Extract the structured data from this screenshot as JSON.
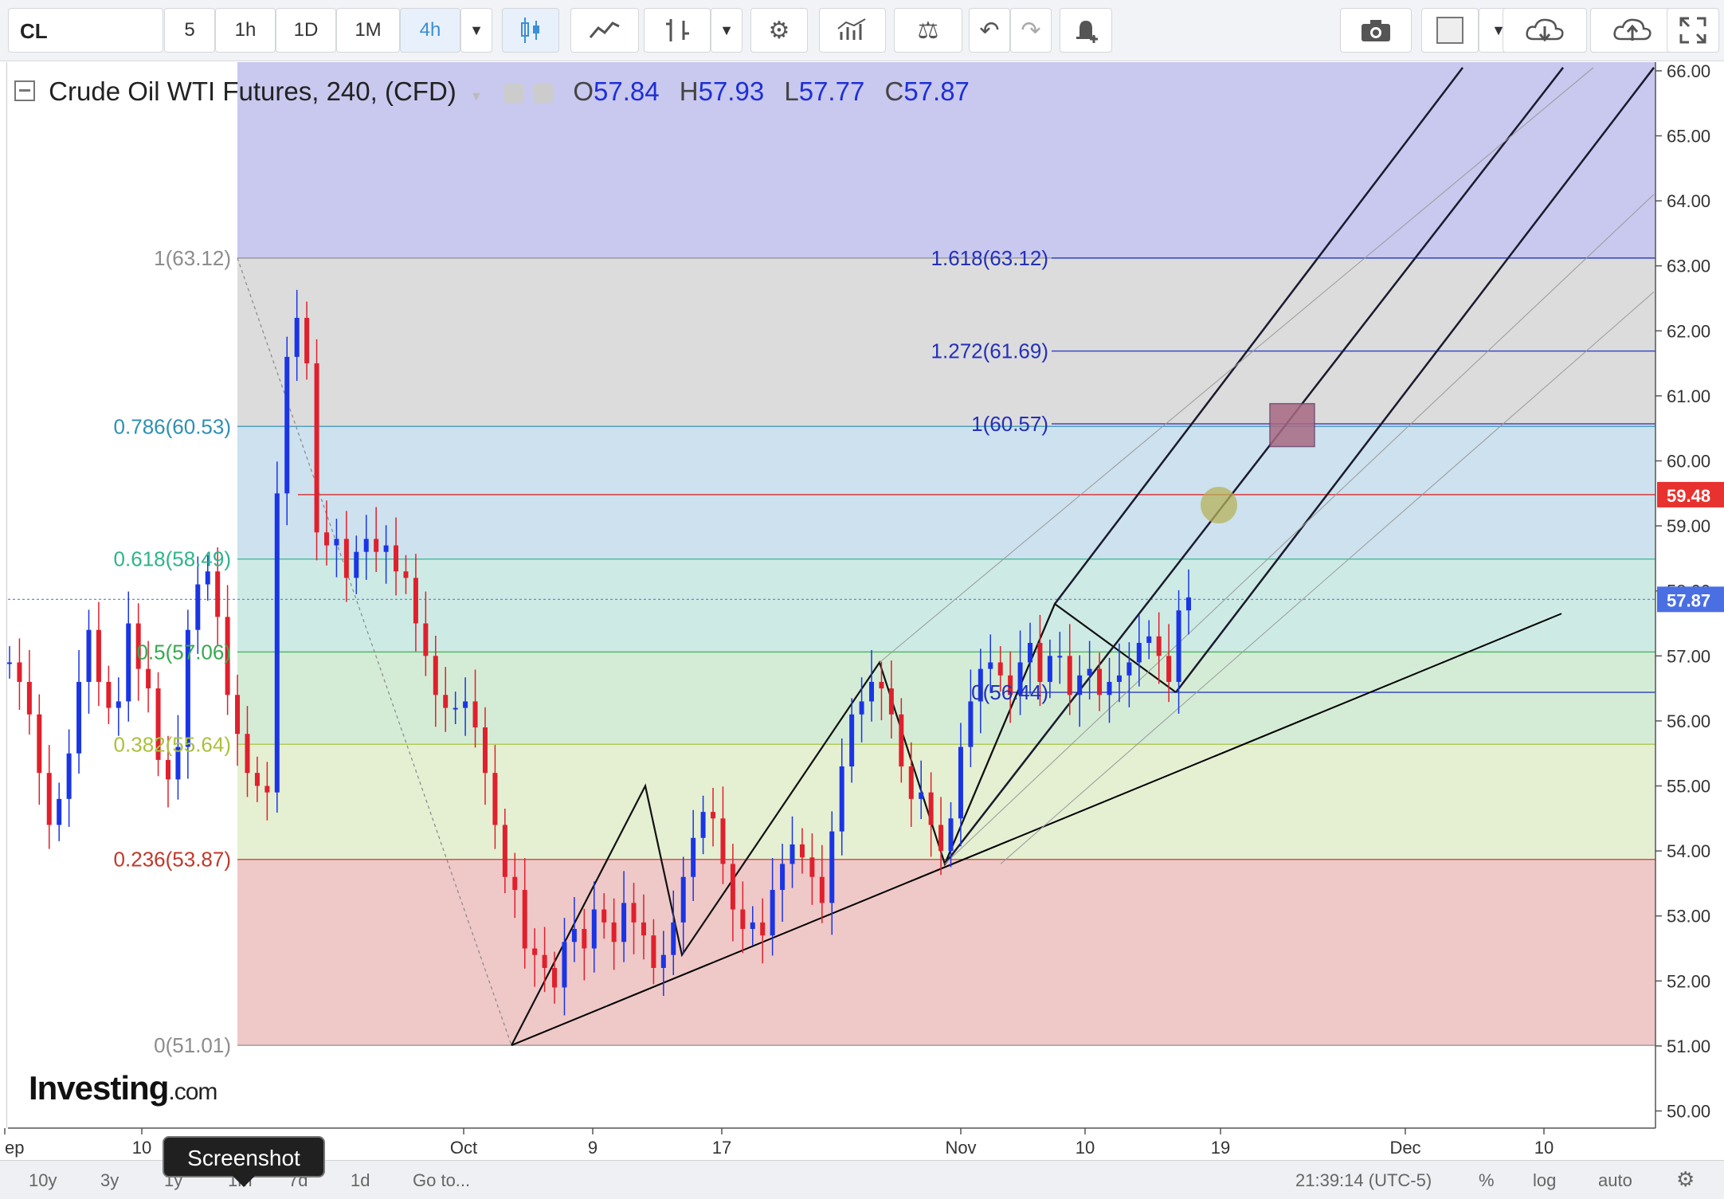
{
  "toolbar": {
    "symbol": "CL",
    "intervals": [
      "5",
      "1h",
      "1D",
      "1M",
      "4h"
    ],
    "active_interval": "4h"
  },
  "legend": {
    "title": "Crude Oil WTI Futures, 240, (CFD)",
    "open_label": "O",
    "open": "57.84",
    "high_label": "H",
    "high": "57.93",
    "low_label": "L",
    "low": "57.77",
    "close_label": "C",
    "close": "57.87"
  },
  "logo": {
    "main": "Investing",
    "suffix": ".com"
  },
  "bottom_bar": {
    "ranges": [
      "10y",
      "3y",
      "1y",
      "1m",
      "7d",
      "1d"
    ],
    "goto": "Go to...",
    "time": "21:39:14 (UTC-5)",
    "percent": "%",
    "log": "log",
    "auto": "auto"
  },
  "tooltip": {
    "text": "Screenshot"
  },
  "chart_data": {
    "type": "candlestick",
    "ylim": [
      49.6,
      66.1
    ],
    "y_ticks": [
      "50.00",
      "51.00",
      "52.00",
      "53.00",
      "54.00",
      "55.00",
      "56.00",
      "57.00",
      "58.00",
      "59.00",
      "60.00",
      "61.00",
      "62.00",
      "63.00",
      "64.00",
      "65.00",
      "66.00"
    ],
    "x_ticks": [
      "ep",
      "10",
      "Oct",
      "9",
      "17",
      "Nov",
      "10",
      "19",
      "Dec",
      "10"
    ],
    "price_label": "57.87",
    "alert_label": "59.48",
    "fib_retracement": [
      {
        "label": "1(63.12)",
        "value": 63.12,
        "color": "#8c8c8c"
      },
      {
        "label": "0.786(60.53)",
        "value": 60.53,
        "color": "#2f8fb4"
      },
      {
        "label": "0.618(58.49)",
        "value": 58.49,
        "color": "#2fb48c"
      },
      {
        "label": "0.5(57.06)",
        "value": 57.06,
        "color": "#36a94e"
      },
      {
        "label": "0.382(55.64)",
        "value": 55.64,
        "color": "#a9c23c"
      },
      {
        "label": "0.236(53.87)",
        "value": 53.87,
        "color": "#c0392b"
      },
      {
        "label": "0(51.01)",
        "value": 51.01,
        "color": "#8c8c8c"
      }
    ],
    "fib_extension": [
      {
        "label": "1.618(63.12)",
        "value": 63.12
      },
      {
        "label": "1.272(61.69)",
        "value": 61.69
      },
      {
        "label": "1(60.57)",
        "value": 60.57
      },
      {
        "label": "0(56.44)",
        "value": 56.44
      }
    ],
    "close_series": [
      56.9,
      56.6,
      56.1,
      55.2,
      54.4,
      54.8,
      55.5,
      56.6,
      57.4,
      56.6,
      56.2,
      56.3,
      57.5,
      56.8,
      56.5,
      55.4,
      55.1,
      55.6,
      57.4,
      58.1,
      58.3,
      57.6,
      56.4,
      55.8,
      55.2,
      55.0,
      54.9,
      59.5,
      61.6,
      62.2,
      61.5,
      58.9,
      58.7,
      58.8,
      58.2,
      58.6,
      58.8,
      58.6,
      58.7,
      58.3,
      58.2,
      57.5,
      57.0,
      56.4,
      56.2,
      56.2,
      56.3,
      55.9,
      55.2,
      54.4,
      53.6,
      53.4,
      52.5,
      52.4,
      52.2,
      51.9,
      52.6,
      52.8,
      52.5,
      53.1,
      52.9,
      52.6,
      53.2,
      52.9,
      52.7,
      52.2,
      52.4,
      52.9,
      53.6,
      54.2,
      54.6,
      54.5,
      53.8,
      53.1,
      52.8,
      52.9,
      52.7,
      53.4,
      53.8,
      54.1,
      53.9,
      53.6,
      53.2,
      54.3,
      55.3,
      56.1,
      56.3,
      56.6,
      56.5,
      56.1,
      55.3,
      54.8,
      54.9,
      54.4,
      54.0,
      54.5,
      55.6,
      56.3,
      56.8,
      56.9,
      56.7,
      56.4,
      56.9,
      57.2,
      56.6,
      57.0,
      57.0,
      56.4,
      56.7,
      56.8,
      56.4,
      56.6,
      56.7,
      56.9,
      57.2,
      57.3,
      57.0,
      56.6,
      57.7,
      57.9
    ]
  }
}
